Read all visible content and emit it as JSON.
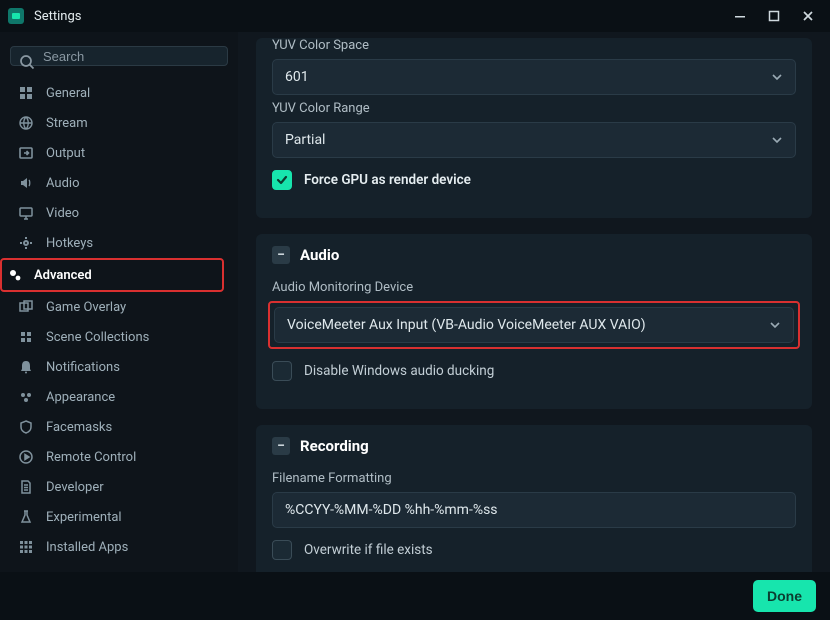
{
  "window": {
    "title": "Settings"
  },
  "sidebar": {
    "search_placeholder": "Search",
    "items": [
      {
        "label": "General",
        "icon": "grid"
      },
      {
        "label": "Stream",
        "icon": "globe"
      },
      {
        "label": "Output",
        "icon": "arrow-right-box"
      },
      {
        "label": "Audio",
        "icon": "volume"
      },
      {
        "label": "Video",
        "icon": "monitor"
      },
      {
        "label": "Hotkeys",
        "icon": "gear"
      },
      {
        "label": "Advanced",
        "icon": "gears",
        "active": true
      },
      {
        "label": "Game Overlay",
        "icon": "overlay"
      },
      {
        "label": "Scene Collections",
        "icon": "collection"
      },
      {
        "label": "Notifications",
        "icon": "bell"
      },
      {
        "label": "Appearance",
        "icon": "palette"
      },
      {
        "label": "Facemasks",
        "icon": "shield"
      },
      {
        "label": "Remote Control",
        "icon": "play-circle"
      },
      {
        "label": "Developer",
        "icon": "doc"
      },
      {
        "label": "Experimental",
        "icon": "flask"
      },
      {
        "label": "Installed Apps",
        "icon": "apps"
      }
    ]
  },
  "main": {
    "yuv_space": {
      "label": "YUV Color Space",
      "value": "601"
    },
    "yuv_range": {
      "label": "YUV Color Range",
      "value": "Partial"
    },
    "force_gpu": {
      "label": "Force GPU as render device",
      "checked": true
    },
    "audio_section": {
      "title": "Audio",
      "monitor_label": "Audio Monitoring Device",
      "monitor_value": "VoiceMeeter Aux Input (VB-Audio VoiceMeeter AUX VAIO)",
      "disable_ducking": {
        "label": "Disable Windows audio ducking",
        "checked": false
      }
    },
    "recording_section": {
      "title": "Recording",
      "filename_label": "Filename Formatting",
      "filename_value": "%CCYY-%MM-%DD %hh-%mm-%ss",
      "overwrite": {
        "label": "Overwrite if file exists",
        "checked": false
      }
    }
  },
  "footer": {
    "done_label": "Done"
  }
}
